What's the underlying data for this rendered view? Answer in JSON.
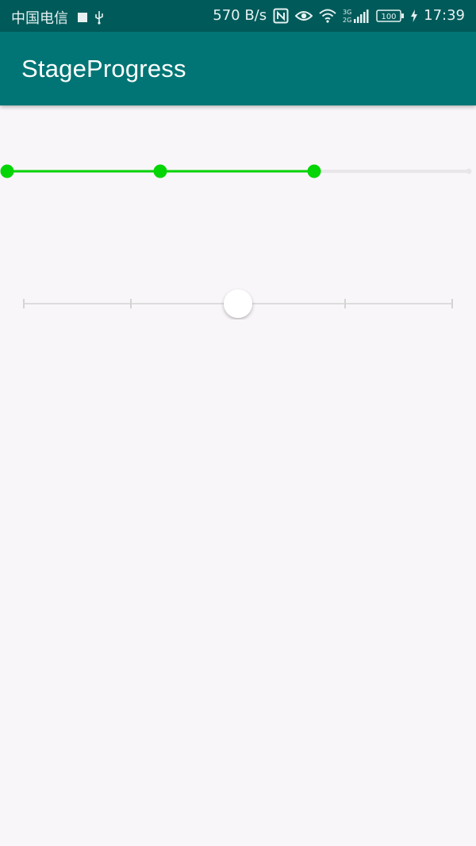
{
  "status_bar": {
    "carrier": "中国电信",
    "net_speed": "570 B/s",
    "network": "3G 2G",
    "battery": "100",
    "time": "17:39"
  },
  "app_bar": {
    "title": "StageProgress"
  },
  "stage_progress": {
    "stages": 4,
    "completed_stages": 2,
    "active_color": "#05d505",
    "inactive_color": "#e9e6e9"
  },
  "seek_bar": {
    "ticks": 5,
    "value_fraction": 0.5,
    "track_color": "#dcdcdc",
    "thumb_color": "#ffffff"
  },
  "colors": {
    "status_bar": "#015a5a",
    "app_bar": "#017575",
    "background": "#f9f6f9"
  }
}
